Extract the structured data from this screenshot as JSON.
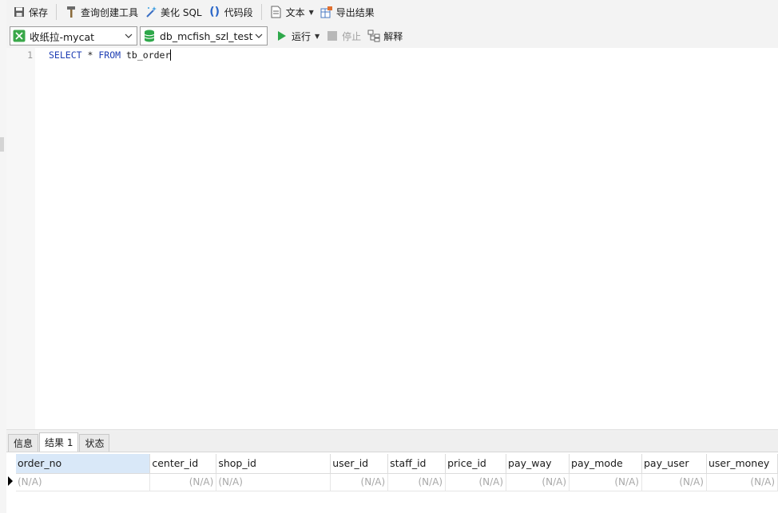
{
  "toolbar_main": {
    "save": "保存",
    "query_builder": "查询创建工具",
    "beautify": "美化 SQL",
    "snippet": "代码段",
    "text": "文本",
    "export": "导出结果"
  },
  "toolbar_run": {
    "connection": "收纸拉-mycat",
    "database": "db_mcfish_szl_test",
    "run": "运行",
    "stop": "停止",
    "explain": "解释"
  },
  "editor": {
    "line_number": "1",
    "keyword_select": "SELECT",
    "star": "*",
    "keyword_from": "FROM",
    "table": "tb_order"
  },
  "tabs": {
    "info": "信息",
    "result": "结果 1",
    "status": "状态"
  },
  "grid": {
    "columns": [
      "order_no",
      "center_id",
      "shop_id",
      "user_id",
      "staff_id",
      "price_id",
      "pay_way",
      "pay_mode",
      "pay_user",
      "user_money"
    ],
    "row": [
      "(N/A)",
      "(N/A)",
      "(N/A)",
      "(N/A)",
      "(N/A)",
      "(N/A)",
      "(N/A)",
      "(N/A)",
      "(N/A)",
      "(N/A)"
    ]
  },
  "colors": {
    "toolbar_bg": "#f3f3f3",
    "sql_keyword": "#1f3fb4",
    "run_green": "#2ea84a",
    "db_green": "#2ea84a",
    "selected_header": "#d9e8f8"
  }
}
